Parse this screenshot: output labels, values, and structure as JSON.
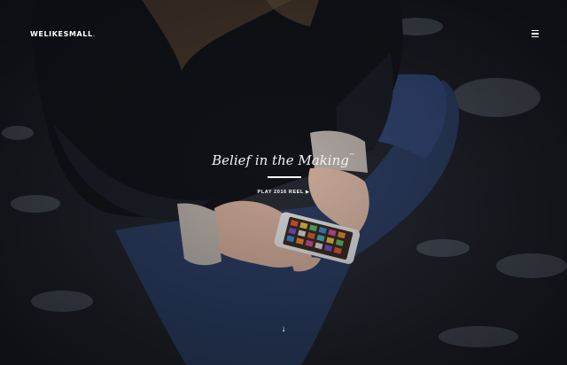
{
  "header": {
    "logo_bold": "WELIKESMALL",
    "logo_dot": ".",
    "menu_icon": "hamburger-menu-icon"
  },
  "hero": {
    "tagline": "Belief in the Making",
    "trademark": "™",
    "cta_label": "PLAY 2016 REEL",
    "cta_icon": "play-triangle-icon",
    "scroll_icon": "arrow-down-icon"
  },
  "colors": {
    "background": "#14161c",
    "text": "#ffffff",
    "jeans": "#2c3f66",
    "jacket": "#101116"
  }
}
